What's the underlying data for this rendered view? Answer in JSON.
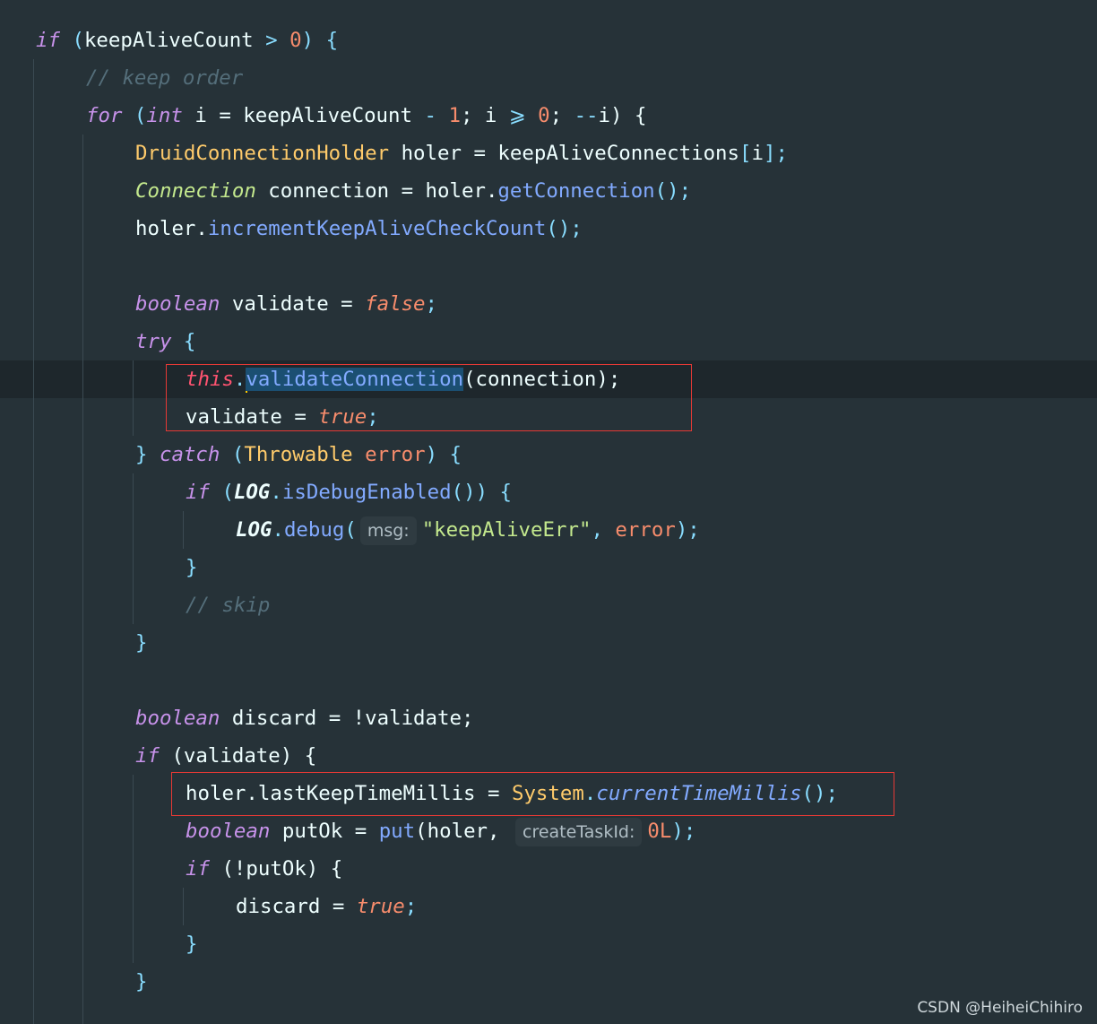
{
  "code": {
    "l1": {
      "kw": "if",
      "p1": " (",
      "var": "keepAliveCount",
      "op": " > ",
      "num": "0",
      "p2": ") {"
    },
    "l2": {
      "comment": "// keep order"
    },
    "l3": {
      "kw_for": "for",
      "p1": " (",
      "kw_int": "int",
      "t1": " i = keepAliveCount ",
      "op1": "-",
      "sp": " ",
      "num1": "1",
      "t2": "; i ",
      "op2": "⩾",
      "sp2": " ",
      "num2": "0",
      "t3": "; ",
      "op3": "--",
      "t4": "i) {"
    },
    "l4": {
      "type": "DruidConnectionHolder",
      "t1": " holer = keepAliveConnections",
      "b1": "[",
      "t2": "i",
      "b2": "]",
      "semi": ";"
    },
    "l5": {
      "type": "Connection",
      "t1": " connection = holer.",
      "fn": "getConnection",
      "t2": "();"
    },
    "l6": {
      "t1": "holer.",
      "fn": "incrementKeepAliveCheckCount",
      "t2": "();"
    },
    "l8": {
      "kw": "boolean",
      "t1": " validate = ",
      "val": "false",
      "semi": ";"
    },
    "l9": {
      "kw": "try",
      "t1": " {"
    },
    "l10": {
      "this": "this",
      "dot": ".",
      "fn": "validateConnection",
      "t1": "(connection);"
    },
    "l11": {
      "t1": "validate = ",
      "val": "true",
      "semi": ";"
    },
    "l12": {
      "t1": "} ",
      "kw": "catch",
      "p1": " (",
      "type": "Throwable",
      "sp": " ",
      "param": "error",
      "p2": ") {"
    },
    "l13": {
      "kw": "if",
      "p1": " (",
      "const": "LOG",
      "dot": ".",
      "fn": "isDebugEnabled",
      "p2": "()) {"
    },
    "l14": {
      "const": "LOG",
      "dot": ".",
      "fn": "debug",
      "p1": "(",
      "hint": "msg:",
      "str": "\"keepAliveErr\"",
      "t1": ", ",
      "param": "error",
      "t2": ");"
    },
    "l15": {
      "t1": "}"
    },
    "l16": {
      "comment": "// skip"
    },
    "l17": {
      "t1": "}"
    },
    "l19": {
      "kw": "boolean",
      "t1": " discard = !validate;"
    },
    "l20": {
      "kw": "if",
      "t1": " (validate) {"
    },
    "l21": {
      "t1": "holer.lastKeepTimeMillis = ",
      "type": "System",
      "dot": ".",
      "fn": "currentTimeMillis",
      "t2": "();"
    },
    "l22": {
      "kw": "boolean",
      "t1": " putOk = ",
      "fn": "put",
      "t2": "(holer, ",
      "hint": "createTaskId:",
      "num": "0L",
      "t3": ");"
    },
    "l23": {
      "kw": "if",
      "t1": " (!putOk) {"
    },
    "l24": {
      "t1": "discard = ",
      "val": "true",
      "semi": ";"
    },
    "l25": {
      "t1": "}"
    },
    "l26": {
      "t1": "}"
    }
  },
  "watermark": "CSDN @HeiheiChihiro",
  "colors": {
    "background": "#263238",
    "keyword": "#c792ea",
    "type": "#ffcb6b",
    "function": "#82aaff",
    "number": "#f78c6c",
    "comment": "#546e7a",
    "string": "#c3e88d",
    "highlight_box": "#e53935"
  }
}
